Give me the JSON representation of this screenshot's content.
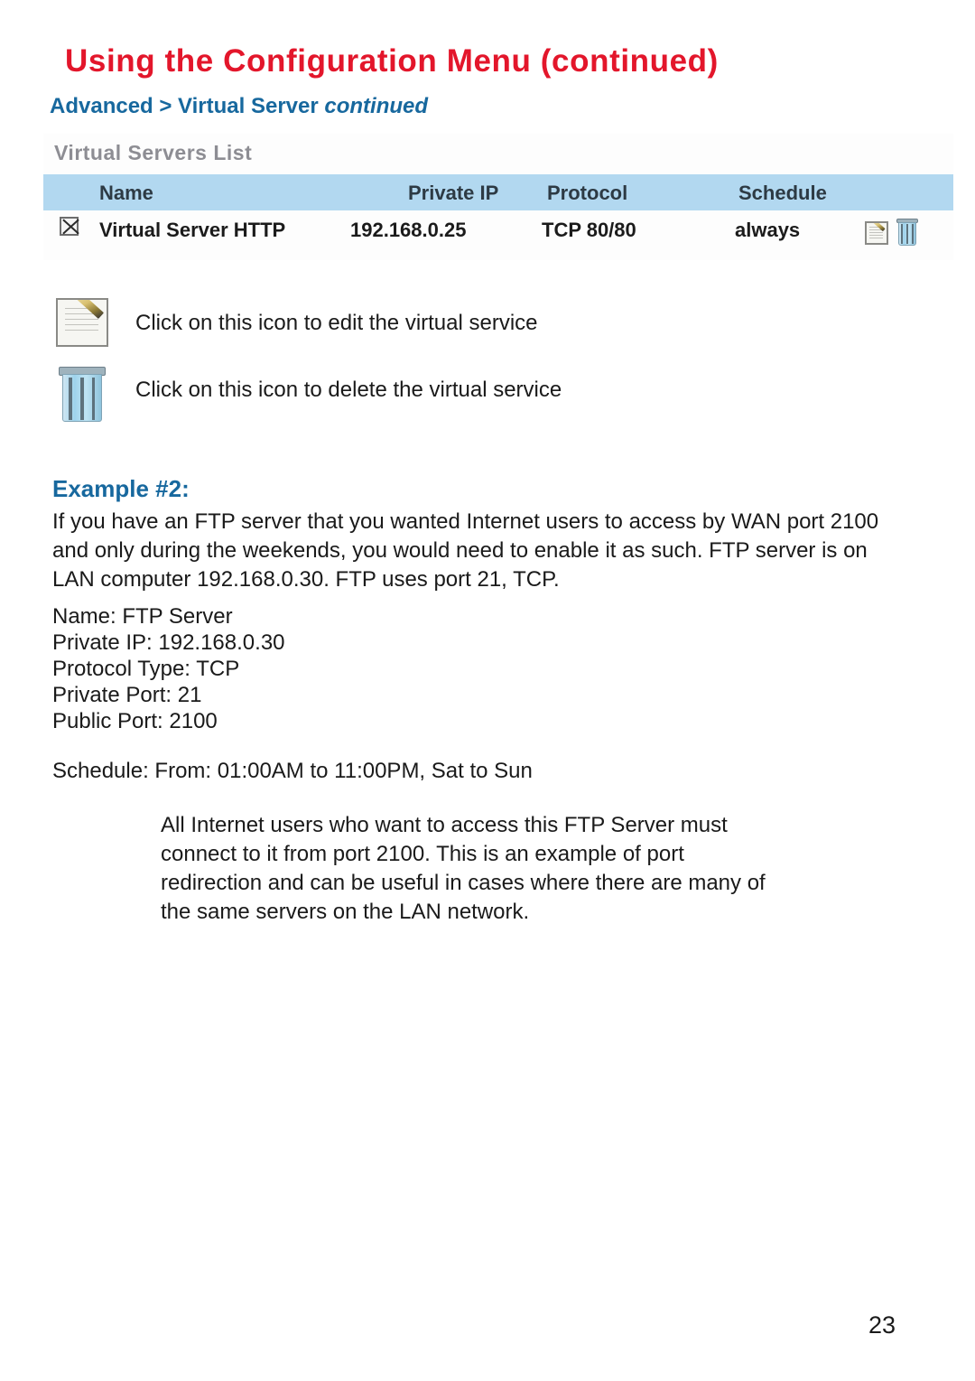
{
  "header": {
    "title": "Using the Configuration Menu (continued)",
    "breadcrumb_plain": "Advanced > Virtual Server ",
    "breadcrumb_italic": "continued",
    "title_color": "#e3162b",
    "accent_color": "#17689e"
  },
  "screenshot": {
    "panel_title": "Virtual Servers List",
    "header_band_color": "#b2d8f0",
    "columns": [
      "Name",
      "Private IP",
      "Protocol",
      "Schedule"
    ],
    "rows": [
      {
        "enabled": true,
        "name": "Virtual Server HTTP",
        "private_ip": "192.168.0.25",
        "protocol": "TCP 80/80",
        "schedule": "always",
        "edit_icon": "edit-icon",
        "delete_icon": "trash-icon"
      }
    ]
  },
  "legend": [
    {
      "icon": "edit-icon",
      "caption": "Click on this icon to edit the virtual service"
    },
    {
      "icon": "trash-icon",
      "caption": "Click on this icon to delete the virtual service"
    }
  ],
  "example": {
    "title": "Example #2:",
    "paragraph": "If you have an FTP server that you wanted Internet users to access by WAN port 2100 and only during the weekends, you would need to enable it as such. FTP server is on LAN computer 192.168.0.30. FTP uses port 21, TCP.",
    "params": [
      "Name: FTP Server",
      "Private IP: 192.168.0.30",
      "Protocol Type: TCP",
      "Private Port: 21",
      "Public Port: 2100"
    ],
    "schedule": "Schedule: From: 01:00AM to 11:00PM, Sat to Sun",
    "note": "All Internet users who want to access this FTP Server must connect to it from port 2100. This is an example of port redirection and can be useful in cases where there are many of the same servers on the LAN network."
  },
  "footer": {
    "page_number": "23"
  }
}
